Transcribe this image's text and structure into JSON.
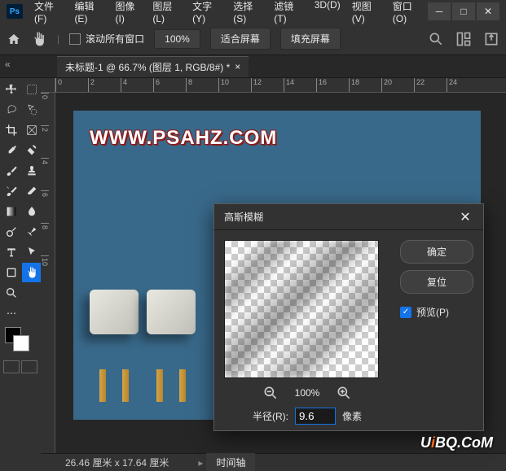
{
  "menu": {
    "file": "文件(F)",
    "edit": "编辑(E)",
    "image": "图像(I)",
    "layer": "图层(L)",
    "type": "文字(Y)",
    "select": "选择(S)",
    "filter": "滤镜(T)",
    "threed": "3D(D)",
    "view": "视图(V)",
    "window": "窗口(O)"
  },
  "optbar": {
    "scroll_all": "滚动所有窗口",
    "zoom": "100%",
    "fit_screen": "适合屏幕",
    "fill_screen": "填充屏幕"
  },
  "document": {
    "tab_title": "未标题-1 @ 66.7% (图层 1, RGB/8#) *",
    "canvas_text": "WWW.PSAHZ.COM",
    "dimensions": "26.46 厘米 x 17.64 厘米",
    "timeline_tab": "时间轴"
  },
  "ruler_h": [
    "0",
    "2",
    "4",
    "6",
    "8",
    "10",
    "12",
    "14",
    "16",
    "18",
    "20",
    "22",
    "24"
  ],
  "ruler_v": [
    "0",
    "2",
    "4",
    "6",
    "8",
    "10"
  ],
  "dialog": {
    "title": "高斯模糊",
    "ok": "确定",
    "reset": "复位",
    "preview": "预览(P)",
    "zoom_level": "100%",
    "radius_label": "半径(R):",
    "radius_value": "9.6",
    "radius_unit": "像素"
  },
  "watermark": {
    "part1": "U",
    "part2": "i",
    "part3": "BQ.CoM"
  }
}
